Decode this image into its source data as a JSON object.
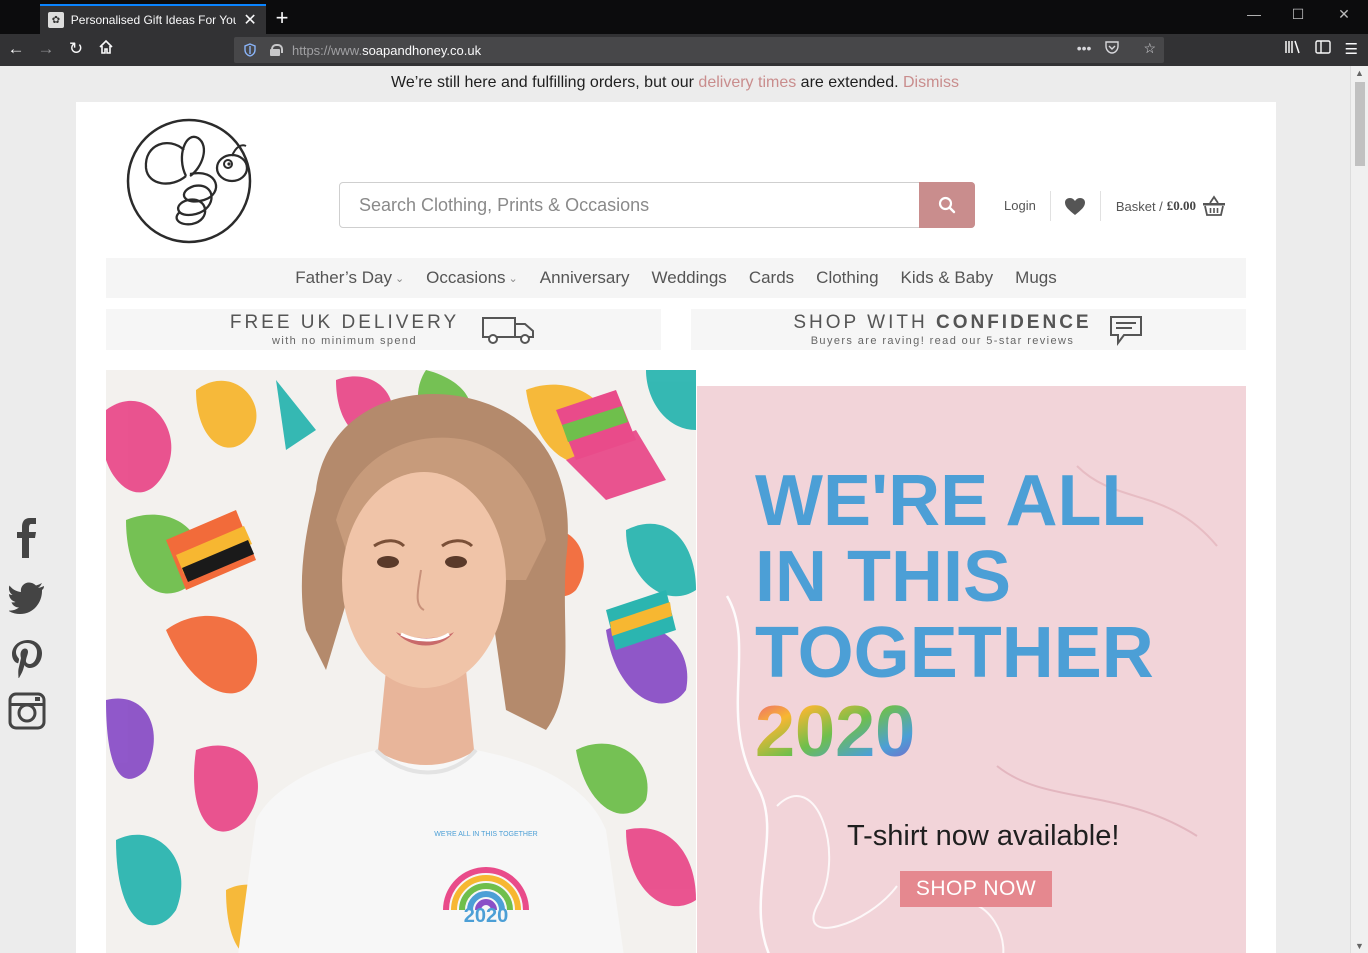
{
  "browser": {
    "tab_title": "Personalised Gift Ideas For You",
    "url_protocol": "https://www.",
    "url_domain": "soapandhoney.co.uk"
  },
  "notice": {
    "text_before": "We’re still here and fulfilling orders, but our ",
    "link": "delivery times",
    "text_after": " are extended. ",
    "dismiss": "Dismiss"
  },
  "search": {
    "placeholder": "Search Clothing, Prints & Occasions"
  },
  "header": {
    "login": "Login",
    "basket_label": "Basket /",
    "basket_amount": "£0.00"
  },
  "nav": {
    "items": [
      {
        "label": "Father’s Day",
        "has_dropdown": true
      },
      {
        "label": "Occasions",
        "has_dropdown": true
      },
      {
        "label": "Anniversary",
        "has_dropdown": false
      },
      {
        "label": "Weddings",
        "has_dropdown": false
      },
      {
        "label": "Cards",
        "has_dropdown": false
      },
      {
        "label": "Clothing",
        "has_dropdown": false
      },
      {
        "label": "Kids & Baby",
        "has_dropdown": false
      },
      {
        "label": "Mugs",
        "has_dropdown": false
      }
    ]
  },
  "promos": {
    "delivery_title": "FREE UK DELIVERY",
    "delivery_sub": "with no minimum spend",
    "confidence_title_a": "SHOP WITH ",
    "confidence_title_b": "CONFIDENCE",
    "confidence_sub": "Buyers are raving! read our 5-star reviews"
  },
  "hero": {
    "line1": "WE'RE ALL",
    "line2": "IN THIS",
    "line3": "TOGETHER",
    "year": "2020",
    "tagline": "T-shirt now available!",
    "cta": "SHOP NOW",
    "shirt_text": "WE'RE ALL IN THIS TOGETHER",
    "shirt_year": "2020"
  },
  "colors": {
    "accent": "#c98d8d",
    "hero_blue": "#4c9fd6",
    "hero_pink": "#f2d4d9",
    "cta": "#e5888f"
  },
  "social": [
    "facebook-icon",
    "twitter-icon",
    "pinterest-icon",
    "instagram-icon"
  ]
}
